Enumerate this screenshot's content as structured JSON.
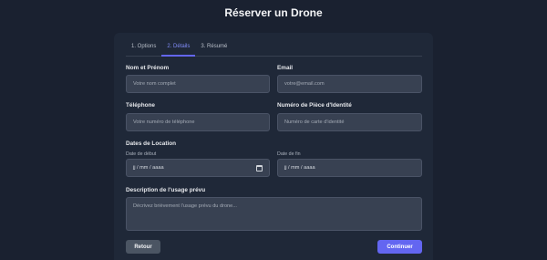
{
  "header": {
    "title": "Réserver un Drone"
  },
  "tabs": [
    {
      "label": "1. Options"
    },
    {
      "label": "2. Détails"
    },
    {
      "label": "3. Résumé"
    }
  ],
  "form": {
    "full_name": {
      "label": "Nom et Prénom",
      "placeholder": "Votre nom complet"
    },
    "email": {
      "label": "Email",
      "placeholder": "votre@email.com"
    },
    "phone": {
      "label": "Téléphone",
      "placeholder": "Votre numéro de téléphone"
    },
    "id_number": {
      "label": "Numéro de Pièce d'Identité",
      "placeholder": "Numéro de carte d'identité"
    },
    "rental_dates": {
      "label": "Dates de Location",
      "start": {
        "label": "Date de début",
        "value": "jj / mm / aaaa"
      },
      "end": {
        "label": "Date de fin",
        "value": "jj / mm / aaaa"
      }
    },
    "usage": {
      "label": "Description de l'usage prévu",
      "placeholder": "Décrivez brièvement l'usage prévu du drone..."
    }
  },
  "buttons": {
    "back": "Retour",
    "continue": "Continuer"
  }
}
